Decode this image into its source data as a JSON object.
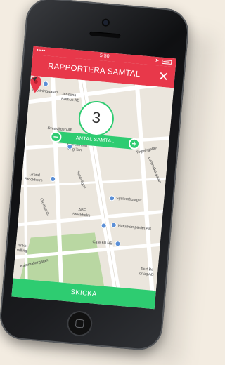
{
  "status_bar": {
    "signal": "•••••",
    "time": "5:50"
  },
  "header": {
    "title": "RAPPORTERA SAMTAL",
    "close_glyph": "✕"
  },
  "counter": {
    "value": "3",
    "label": "ANTAL SAMTAL",
    "minus_glyph": "−",
    "plus_glyph": "+"
  },
  "map": {
    "labels": {
      "street_1": "Drottninggatan",
      "place_1a": "Jensens",
      "place_1b": "Bøfhus AB",
      "place_2": "Sveavägen AB",
      "place_3a": "Restaurang",
      "place_3b": "King Tan",
      "street_2": "Tegnérgatan",
      "street_3": "Luntmakargatan",
      "place_4a": "Grand",
      "place_4b": "Stockholm",
      "street_4": "Sveavägen",
      "place_5": "Systembolaget",
      "place_6a": "ABF",
      "place_6b": "Stockholm",
      "street_5": "Olofsgatan",
      "place_7": "Naturkompaniet AB",
      "place_8": "Café 60 HB",
      "place_9a": "fsriks",
      "place_9b": "vdling",
      "street_6": "Kammakargatan",
      "place_10a": "bert Bo",
      "place_10b": "orlag AB"
    }
  },
  "submit": {
    "label": "SKICKA"
  },
  "colors": {
    "header_red": "#e8384a",
    "accent_green": "#2ecc71",
    "pin_red": "#e8384a"
  }
}
